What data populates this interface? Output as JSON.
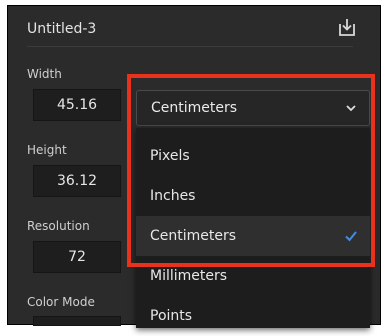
{
  "document": {
    "title": "Untitled-3"
  },
  "icons": {
    "save": "save-download-icon",
    "chevron": "chevron-down-icon",
    "check": "checkmark-icon"
  },
  "fields": {
    "width": {
      "label": "Width",
      "value": "45.16"
    },
    "height": {
      "label": "Height",
      "value": "36.12"
    },
    "resolution": {
      "label": "Resolution",
      "value": "72"
    },
    "color_mode": {
      "label": "Color Mode"
    }
  },
  "unit_select": {
    "selected": "Centimeters",
    "options": [
      "Pixels",
      "Inches",
      "Centimeters",
      "Millimeters",
      "Points"
    ]
  },
  "colors": {
    "panel_bg": "#2b2b2b",
    "highlight": "#e8321b",
    "check": "#3d8ee8"
  }
}
